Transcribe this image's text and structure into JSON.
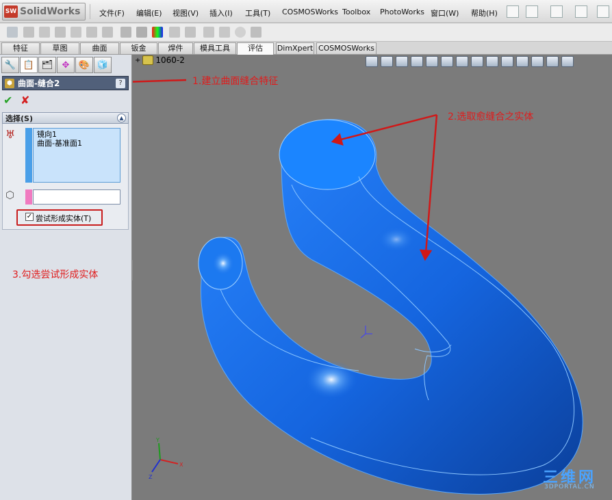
{
  "app": {
    "logo_text": "SolidWorks",
    "logo_badge": "SW"
  },
  "menu": [
    "文件(F)",
    "编辑(E)",
    "视图(V)",
    "插入(I)",
    "工具(T)",
    "COSMOSWorks",
    "Toolbox",
    "PhotoWorks",
    "窗口(W)",
    "帮助(H)"
  ],
  "command_tabs": [
    "特征",
    "草图",
    "曲面",
    "钣金",
    "焊件",
    "模具工具",
    "评估",
    "DimXpert",
    "COSMOSWorks"
  ],
  "active_command_tab": "评估",
  "feature_tree": {
    "root_label": "1060-2",
    "expand_glyph": "+"
  },
  "property_manager": {
    "title": "曲面-缝合2",
    "help": "?",
    "ok": "✔",
    "cancel": "✘",
    "group_title": "选择(S)",
    "selection_items": [
      "镜向1",
      "曲面-基准面1"
    ],
    "option_checkbox_label": "尝试形成实体(T)",
    "option_checked": true,
    "check_glyph": "✓"
  },
  "annotations": {
    "step1": "1.建立曲面缝合特征",
    "step2": "2.选取愈缝合之实体",
    "step3": "3.勾选尝试形成实体"
  },
  "triad": {
    "x": "X",
    "y": "Y",
    "z": "Z"
  },
  "watermark": {
    "cn": "三维网",
    "en": "3DPORTAL.CN"
  },
  "colors": {
    "model_blue": "#1a6fe6",
    "annotation_red": "#e01c1c",
    "header_blue": "#51607a"
  }
}
